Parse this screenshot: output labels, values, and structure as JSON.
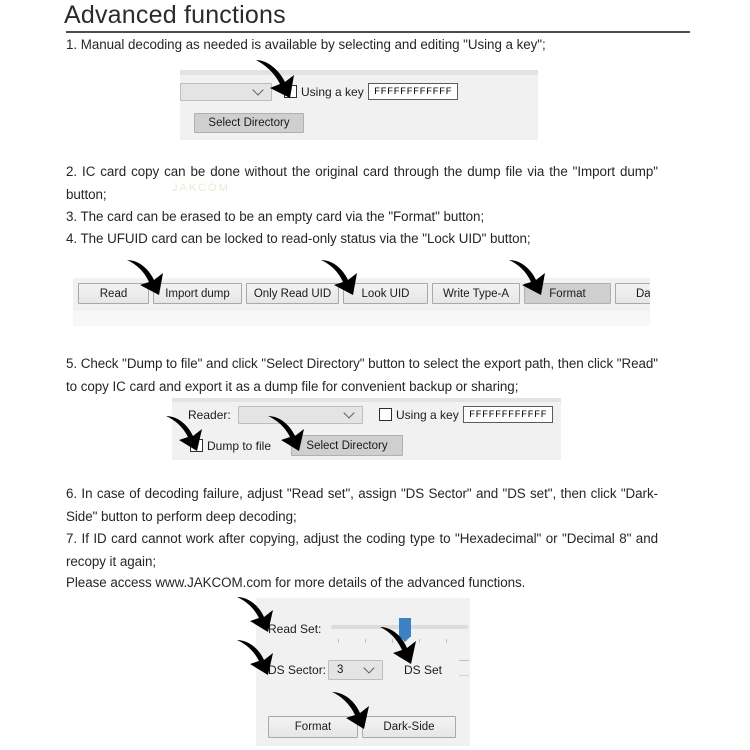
{
  "document": {
    "title": "Advanced functions",
    "watermark": "JAKCOM"
  },
  "paragraphs": {
    "item1": "1. Manual decoding as needed is available by selecting and editing \"Using a key\";",
    "item2": "2. IC card copy can be done without the original card through the dump file via the \"Import dump\" button;",
    "item3": "3. The card can be erased to be an empty card via the \"Format\" button;",
    "item4": "4. The UFUID card can be locked to read-only status via the \"Lock UID\" button;",
    "item5": "5. Check \"Dump to file\" and click \"Select Directory\" button to select the export path, then click \"Read\" to copy IC card and export it as a dump file for convenient backup or sharing;",
    "item6": "6. In case of decoding failure, adjust \"Read set\", assign \"DS Sector\" and \"DS set\", then click \"Dark-Side\" button to perform deep decoding;",
    "item7": "7. If ID card cannot work after copying, adjust the coding type to \"Hexadecimal\" or \"Decimal 8\" and recopy it again;",
    "item8": "Please access www.JAKCOM.com for more details of the advanced functions."
  },
  "panel_key": {
    "reader_combo_value": "",
    "using_key_label": "Using a key",
    "key_value": "FFFFFFFFFFFF",
    "select_directory_label": "Select Directory"
  },
  "toolbar": {
    "buttons": [
      {
        "label": "Read"
      },
      {
        "label": "Import dump"
      },
      {
        "label": "Only Read UID"
      },
      {
        "label": "Look UID"
      },
      {
        "label": "Write Type-A"
      },
      {
        "label": "Format"
      },
      {
        "label": "Da"
      }
    ]
  },
  "panel_dump": {
    "reader_label": "Reader:",
    "reader_combo_value": "",
    "dump_to_file_label": "Dump to file",
    "select_directory_label": "Select Directory",
    "using_key_label": "Using a key",
    "key_value": "FFFFFFFFFFFF"
  },
  "panel_darkside": {
    "read_set_label": "Read Set:",
    "ds_sector_label": "DS Sector:",
    "ds_sector_value": "3",
    "ds_set_label": "DS Set",
    "format_label": "Format",
    "dark_side_label": "Dark-Side"
  },
  "colors": {
    "panel_background": "#f1f1f1",
    "panel_strip": "#e3e3e3",
    "slider_thumb": "#3b82c4",
    "text": "#262626",
    "arrow": "#000000"
  }
}
